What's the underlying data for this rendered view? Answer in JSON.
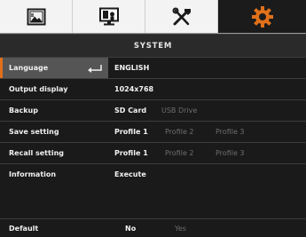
{
  "tabs": [
    {
      "name": "picture-tab",
      "icon": "image-icon",
      "active": false
    },
    {
      "name": "display-tab",
      "icon": "monitor-icon",
      "active": false
    },
    {
      "name": "tools-tab",
      "icon": "tools-icon",
      "active": false
    },
    {
      "name": "system-tab",
      "icon": "gear-icon",
      "active": true
    }
  ],
  "header": {
    "title": "SYSTEM"
  },
  "rows": [
    {
      "label": "Language",
      "options": [
        "ENGLISH"
      ],
      "selected": 0
    },
    {
      "label": "Output display",
      "options": [
        "1024x768"
      ],
      "selected": 0
    },
    {
      "label": "Backup",
      "options": [
        "SD Card",
        "USB Drive"
      ],
      "selected": 0
    },
    {
      "label": "Save setting",
      "options": [
        "Profile 1",
        "Profile 2",
        "Profile 3"
      ],
      "selected": 0
    },
    {
      "label": "Recall setting",
      "options": [
        "Profile 1",
        "Profile 2",
        "Profile 3"
      ],
      "selected": 0
    },
    {
      "label": "Information",
      "options": [
        "Execute"
      ],
      "selected": 0
    },
    {
      "label": "Default",
      "options": [
        "No",
        "Yes"
      ],
      "selected": 0
    }
  ],
  "colors": {
    "accent": "#e0701a",
    "background": "#1a1a1a",
    "selected_row": "#555555",
    "inactive_option": "#6e6e6e"
  }
}
